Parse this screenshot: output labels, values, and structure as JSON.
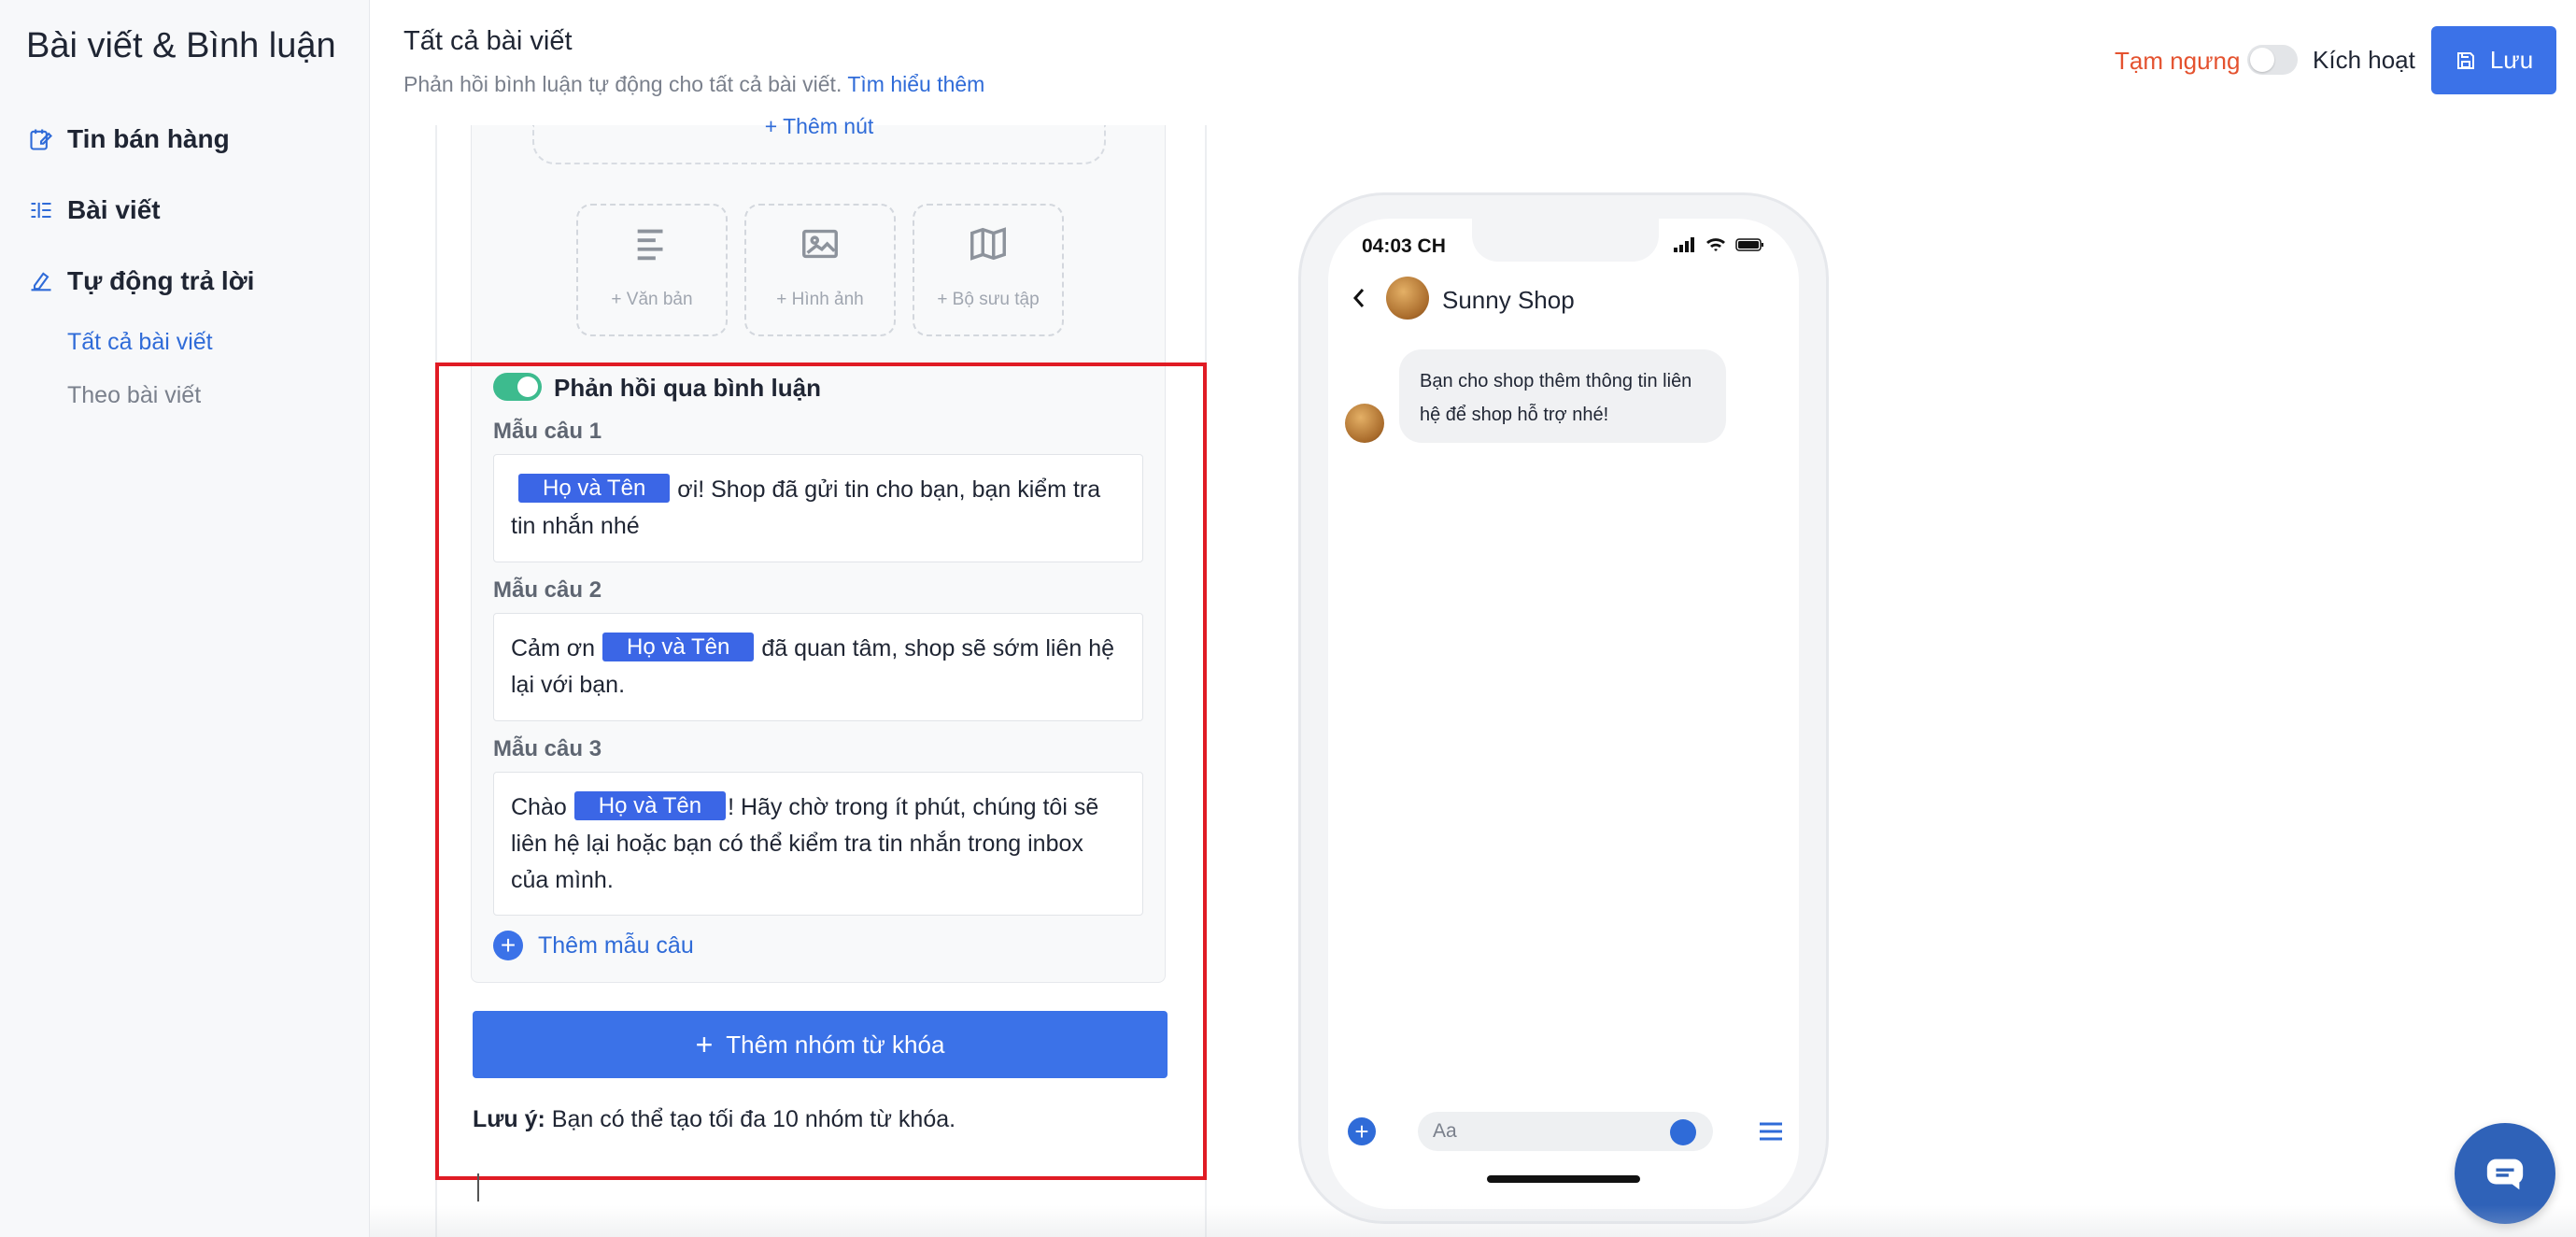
{
  "sidebar": {
    "title": "Bài viết & Bình luận",
    "items": [
      {
        "label": "Tin bán hàng",
        "icon": "edit-note-icon"
      },
      {
        "label": "Bài viết",
        "icon": "list-icon"
      },
      {
        "label": "Tự động trả lời",
        "icon": "auto-reply-icon"
      }
    ],
    "sub_items": [
      {
        "label": "Tất cả bài viết",
        "active": true
      },
      {
        "label": "Theo bài viết",
        "active": false
      }
    ]
  },
  "header": {
    "title": "Tất cả bài viết",
    "subtitle": "Phản hồi bình luận tự động cho tất cả bài viết.",
    "learn_more": "Tìm hiểu thêm",
    "pause_label": "Tạm ngưng",
    "activate_label": "Kích hoạt",
    "save_label": "Lưu"
  },
  "editor": {
    "add_button_label": "+ Thêm nút",
    "media_tiles": [
      {
        "label": "+ Văn bản",
        "icon": "text-icon"
      },
      {
        "label": "+ Hình ảnh",
        "icon": "image-icon"
      },
      {
        "label": "+ Bộ sưu tập",
        "icon": "map-icon"
      }
    ],
    "reply_toggle_label": "Phản hồi qua bình luận",
    "templates": [
      {
        "label": "Mẫu câu 1",
        "before": "",
        "tag": "Họ và Tên",
        "after": "ơi! Shop đã gửi tin cho bạn, bạn kiểm tra tin nhắn nhé"
      },
      {
        "label": "Mẫu câu 2",
        "before": "Cảm ơn",
        "tag": "Họ và Tên",
        "after": "đã quan tâm, shop sẽ sớm liên hệ lại với bạn."
      },
      {
        "label": "Mẫu câu 3",
        "before": "Chào",
        "tag": "Họ và Tên",
        "after": "! Hãy chờ trong ít phút, chúng tôi sẽ liên hệ lại hoặc bạn có thể kiểm tra tin nhắn trong inbox của mình."
      }
    ],
    "add_template_label": "Thêm mẫu câu",
    "add_keyword_group_label": "Thêm nhóm từ khóa",
    "note_bold": "Lưu ý:",
    "note_text": "Bạn có thể tạo tối đa 10 nhóm từ khóa."
  },
  "phone": {
    "time": "04:03 CH",
    "shop_name": "Sunny Shop",
    "message": "Bạn cho shop thêm thông tin liên hệ để shop hỗ trợ nhé!",
    "composer_placeholder": "Aa"
  },
  "colors": {
    "primary": "#3b72e8",
    "tag": "#3b66e6",
    "toggle_on": "#3dbb8e",
    "pause": "#e4522f",
    "highlight": "#e01b24"
  }
}
